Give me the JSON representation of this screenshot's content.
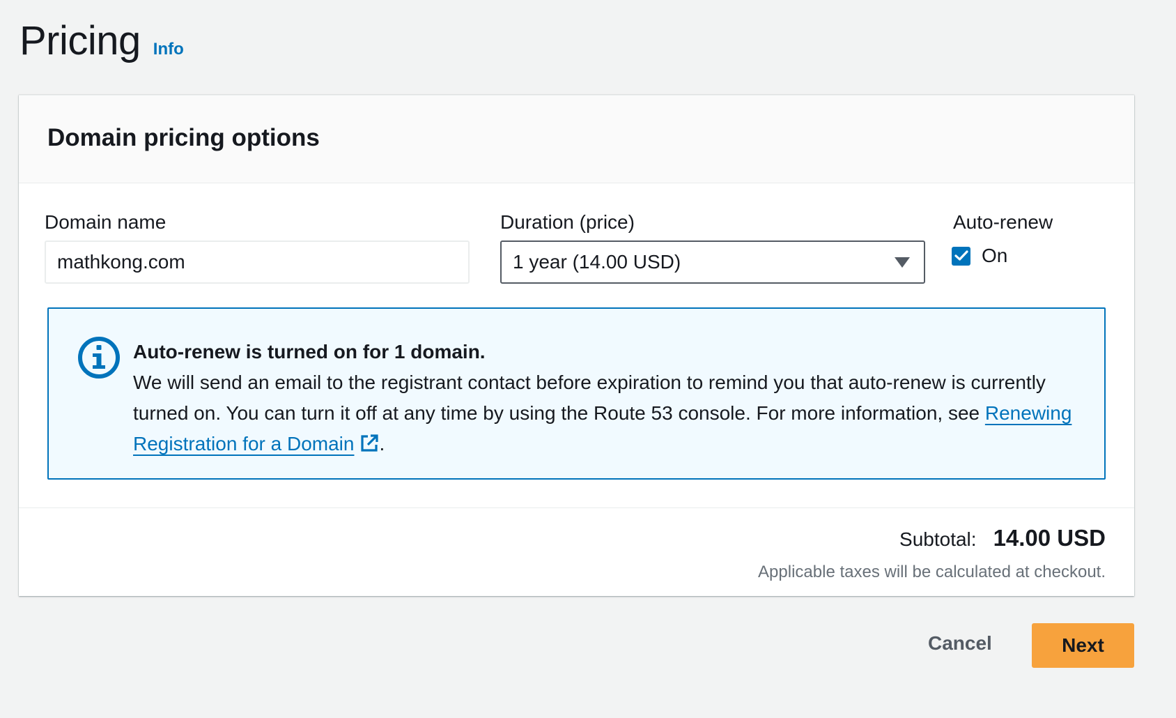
{
  "page": {
    "title": "Pricing",
    "info_label": "Info"
  },
  "container": {
    "title": "Domain pricing options"
  },
  "form": {
    "domain_name_label": "Domain name",
    "domain_name_value": "mathkong.com",
    "duration_label": "Duration (price)",
    "duration_value": "1 year (14.00 USD)",
    "auto_renew_label": "Auto-renew",
    "auto_renew_checkbox_label": "On",
    "auto_renew_checked": true
  },
  "alert": {
    "title": "Auto-renew is turned on for 1 domain.",
    "body": "We will send an email to the registrant contact before expiration to remind you that auto-renew is currently turned on. You can turn it off at any time by using the Route 53 console. For more information, see ",
    "link_text": "Renewing Registration for a Domain",
    "trailing": "."
  },
  "summary": {
    "subtotal_label": "Subtotal:",
    "subtotal_value": "14.00 USD",
    "tax_note": "Applicable taxes will be calculated at checkout."
  },
  "actions": {
    "cancel_label": "Cancel",
    "next_label": "Next"
  },
  "colors": {
    "link": "#0073bb",
    "primary_button": "#f7a23d",
    "alert_background": "#f1faff",
    "page_background": "#f2f3f3"
  },
  "icons": {
    "info": "info-circle-icon",
    "external": "external-link-icon",
    "caret": "caret-down-icon",
    "check": "checkmark-icon"
  }
}
